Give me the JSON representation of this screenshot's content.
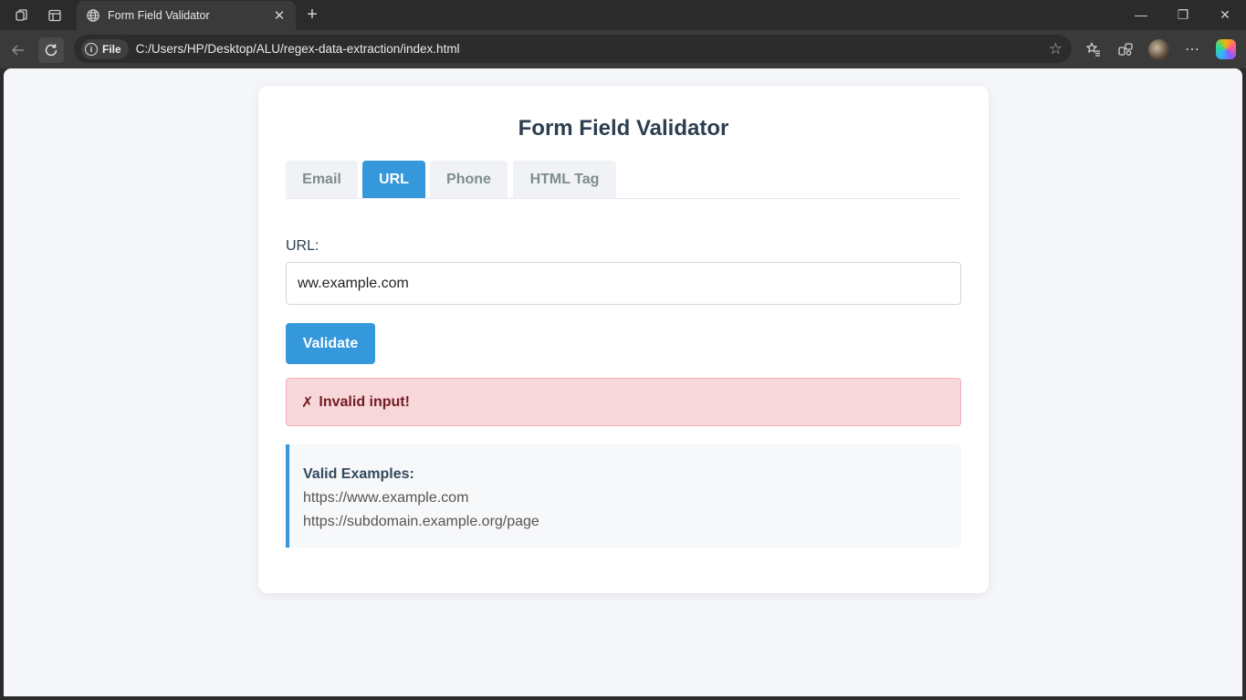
{
  "browser": {
    "tab_title": "Form Field Validator",
    "new_tab_glyph": "+",
    "close_tab_glyph": "✕",
    "site_info_label": "File",
    "address": "C:/Users/HP/Desktop/ALU/regex-data-extraction/index.html",
    "window_controls": {
      "minimize": "—",
      "restore": "❐",
      "close": "✕"
    }
  },
  "page": {
    "title": "Form Field Validator",
    "tabs": [
      {
        "label": "Email",
        "active": false
      },
      {
        "label": "URL",
        "active": true
      },
      {
        "label": "Phone",
        "active": false
      },
      {
        "label": "HTML Tag",
        "active": false
      }
    ],
    "field_label": "URL:",
    "input_value": "ww.example.com",
    "validate_label": "Validate",
    "result": {
      "icon": "✗",
      "text": "Invalid input!"
    },
    "examples": {
      "title": "Valid Examples:",
      "items": [
        "https://www.example.com",
        "https://subdomain.example.org/page"
      ]
    }
  },
  "colors": {
    "accent": "#3498db",
    "error_bg": "#f8d7da",
    "error_text": "#721c24",
    "heading": "#2c3e50"
  }
}
